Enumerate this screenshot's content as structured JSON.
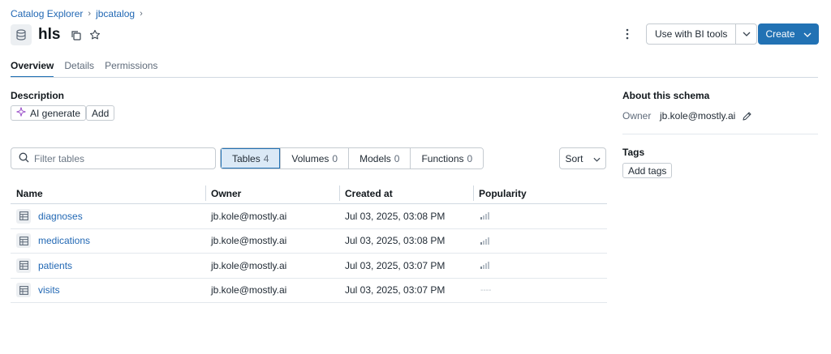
{
  "breadcrumb": {
    "root": "Catalog Explorer",
    "catalog": "jbcatalog"
  },
  "header": {
    "title": "hls",
    "bi_tools_label": "Use with BI tools",
    "create_label": "Create"
  },
  "tabs": [
    {
      "label": "Overview",
      "active": true
    },
    {
      "label": "Details",
      "active": false
    },
    {
      "label": "Permissions",
      "active": false
    }
  ],
  "description": {
    "heading": "Description",
    "ai_generate_label": "AI generate",
    "add_label": "Add"
  },
  "filter": {
    "placeholder": "Filter tables",
    "segments": [
      {
        "label": "Tables",
        "count": "4",
        "active": true
      },
      {
        "label": "Volumes",
        "count": "0",
        "active": false
      },
      {
        "label": "Models",
        "count": "0",
        "active": false
      },
      {
        "label": "Functions",
        "count": "0",
        "active": false
      }
    ],
    "sort_label": "Sort"
  },
  "table": {
    "columns": [
      "Name",
      "Owner",
      "Created at",
      "Popularity"
    ],
    "rows": [
      {
        "name": "diagnoses",
        "owner": "jb.kole@mostly.ai",
        "created": "Jul 03, 2025, 03:08 PM",
        "popularity": 1
      },
      {
        "name": "medications",
        "owner": "jb.kole@mostly.ai",
        "created": "Jul 03, 2025, 03:08 PM",
        "popularity": 1
      },
      {
        "name": "patients",
        "owner": "jb.kole@mostly.ai",
        "created": "Jul 03, 2025, 03:07 PM",
        "popularity": 1
      },
      {
        "name": "visits",
        "owner": "jb.kole@mostly.ai",
        "created": "Jul 03, 2025, 03:07 PM",
        "popularity": 0
      }
    ]
  },
  "about": {
    "heading": "About this schema",
    "owner_label": "Owner",
    "owner_value": "jb.kole@mostly.ai",
    "tags_heading": "Tags",
    "add_tags_label": "Add tags"
  },
  "colors": {
    "accent": "#2272b4",
    "link": "#2268b4"
  },
  "icons": {
    "schema": "database-icon",
    "copy": "copy-icon",
    "favorite": "star-icon",
    "more": "kebab-menu-icon",
    "search": "search-icon",
    "table": "table-icon",
    "edit": "pencil-icon",
    "sparkle": "sparkle-icon"
  }
}
